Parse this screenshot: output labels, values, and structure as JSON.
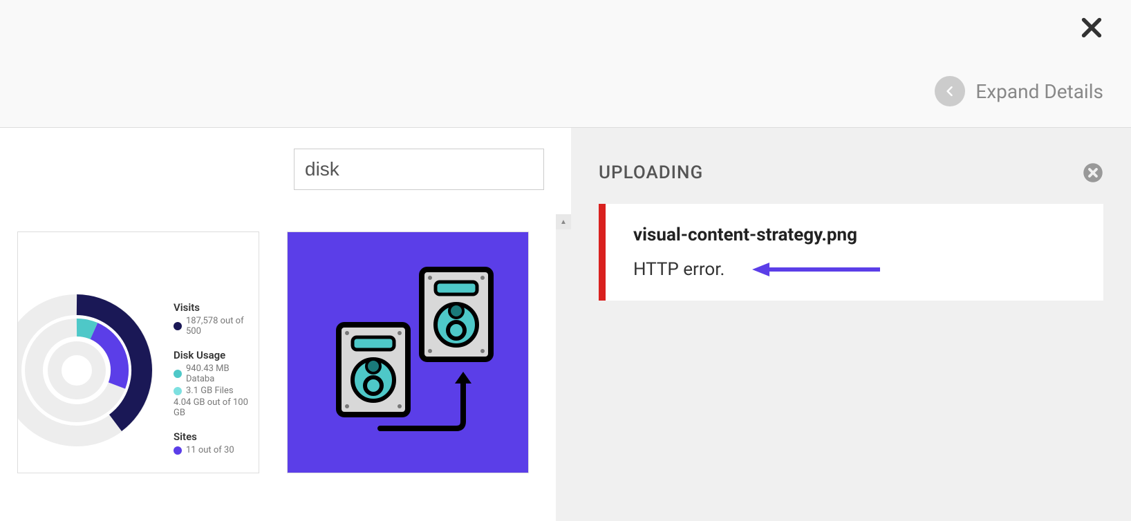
{
  "header": {
    "expand_label": "Expand Details"
  },
  "search": {
    "value": "disk"
  },
  "thumbnails": {
    "thumb1": {
      "visits": {
        "title": "Visits",
        "line": "187,578 out of 500"
      },
      "disk_usage": {
        "title": "Disk Usage",
        "line1": "940.43 MB Databa",
        "line2": "3.1 GB Files",
        "line3": "4.04 GB out of 100 GB"
      },
      "sites": {
        "title": "Sites",
        "line": "11 out of 30"
      }
    }
  },
  "upload": {
    "title": "UPLOADING",
    "filename": "visual-content-strategy.png",
    "error": "HTTP error."
  },
  "colors": {
    "purple": "#5b3ee8",
    "darknavy": "#1a1856",
    "teal": "#4ec8c8",
    "red": "#d9211f"
  }
}
